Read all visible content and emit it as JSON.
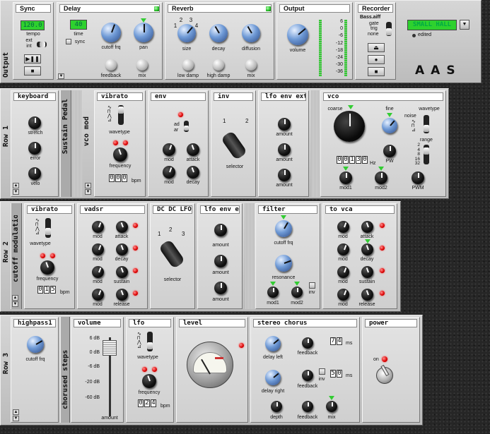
{
  "rack": {
    "output": {
      "label": "Output",
      "sync": {
        "title": "Sync",
        "tempo_value": "120.0",
        "tempo_label": "tempo",
        "ext": "ext",
        "int": "int",
        "play": "▶❚❚",
        "stop": "■"
      },
      "delay": {
        "title": "Delay",
        "time_value": "40",
        "time_label": "time",
        "sync_label": "sync",
        "cutoff": "cutoff frq",
        "pan": "pan",
        "feedback": "feedback",
        "mix": "mix"
      },
      "reverb": {
        "title": "Reverb",
        "size": "size",
        "decay": "decay",
        "diffusion": "diffusion",
        "low_damp": "low damp",
        "high_damp": "high damp",
        "mix": "mix",
        "n1": "1",
        "n2": "2",
        "n3": "3",
        "n4": "4"
      },
      "out": {
        "title": "Output",
        "volume": "volume",
        "meter": [
          "6",
          "0",
          "-6",
          "-12",
          "-18",
          "-24",
          "-30",
          "-36"
        ]
      },
      "recorder": {
        "title": "Recorder",
        "file": "Bass.aiff",
        "gate": "gate",
        "trig": "trig",
        "none": "none",
        "eject": "⏏",
        "rec": "●",
        "stop": "■"
      },
      "preset": {
        "name": "SMALL HALL",
        "edited": "edited"
      },
      "logo": "AAS"
    },
    "row1": {
      "label": "Row 1",
      "sustain": "Sustain Pedal",
      "vcomod": "vco mod",
      "keyboard": {
        "title": "keyboard",
        "stretch": "stretch",
        "error": "error",
        "velo": "velo"
      },
      "vibrato": {
        "title": "vibrato",
        "waveform": "wavetype",
        "frequency": "frequency",
        "digits": [
          "0",
          "0",
          "0"
        ],
        "unit": "bpm"
      },
      "env": {
        "title": "env",
        "ad": "ad",
        "ar": "ar",
        "mod1": "mod",
        "attack": "attack",
        "mod2": "mod",
        "decay": "decay"
      },
      "inv": {
        "title": "inv",
        "n1": "1",
        "n2": "2",
        "selector": "selector"
      },
      "lfo": {
        "title": "lfo env ext",
        "a1": "amount",
        "a2": "amount",
        "a3": "amount"
      },
      "vco": {
        "title": "vco",
        "coarse": "coarse",
        "fine": "fine",
        "wavetype": "wavetype",
        "noise": "noise",
        "range": "range",
        "ranges": [
          "2",
          "4",
          "8",
          "16",
          "32"
        ],
        "digits": [
          "0",
          "0",
          "1",
          "3",
          "0"
        ],
        "hz": "Hz",
        "pw": "PW",
        "mod1": "mod1",
        "mod2": "mod2",
        "pwm": "PWM"
      }
    },
    "row2": {
      "label": "Row 2",
      "cutoff": "cutoff modulation",
      "vibrato": {
        "title": "vibrato",
        "waveform": "wavetype",
        "frequency": "frequency",
        "digits": [
          "0",
          "1",
          "5"
        ],
        "unit": "bpm"
      },
      "vadsr": {
        "title": "vadsr",
        "mod": "mod",
        "attack": "attack",
        "decay": "decay",
        "sustain": "sustain",
        "release": "release"
      },
      "dc": {
        "title": "DC DC LFO",
        "n1": "1",
        "n2": "2",
        "n3": "3",
        "selector": "selector"
      },
      "lfo": {
        "title": "lfo env ext",
        "a1": "amount",
        "a2": "amount",
        "a3": "amount"
      },
      "filter": {
        "title": "filter",
        "cutoff": "cutoff frq",
        "resonance": "resonance",
        "mod1": "mod1",
        "mod2": "mod2",
        "inv": "inv"
      },
      "tovca": {
        "title": "to vca",
        "mod": "mod",
        "attack": "attack",
        "decay": "decay",
        "sustain": "sustain",
        "release": "release"
      }
    },
    "row3": {
      "label": "Row 3",
      "chorused": "chorused steps",
      "highpass": {
        "title": "highpass1",
        "cutoff": "cutoff frq"
      },
      "volume": {
        "title": "volume",
        "marks": [
          "6 dB",
          "0 dB",
          "-6 dB",
          "-20 dB",
          "-60 dB"
        ],
        "amount": "amount"
      },
      "lfo": {
        "title": "lfo",
        "waveform": "wavetype",
        "frequency": "frequency",
        "digits": [
          "0",
          "2",
          "4"
        ],
        "unit": "bpm"
      },
      "level": {
        "title": "level"
      },
      "chorus": {
        "title": "stereo chorus",
        "delay_left": "delay left",
        "delay_right": "delay right",
        "feedback1": "feedback",
        "feedback2": "feedback",
        "feedback3": "feedback",
        "depth": "depth",
        "mix": "mix",
        "inv": "inv",
        "ms1": [
          "7",
          "4"
        ],
        "ms2": [
          "5",
          "0"
        ],
        "ms": "ms"
      },
      "power": {
        "title": "power",
        "on": "on"
      }
    }
  }
}
